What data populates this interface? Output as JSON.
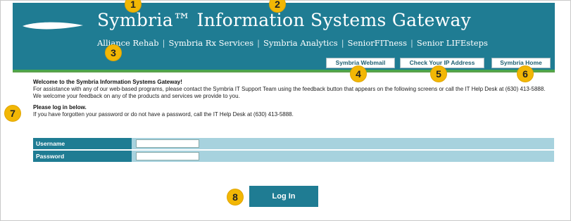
{
  "header": {
    "title": "Symbria™ Information Systems Gateway",
    "nav_links": [
      "Alliance Rehab",
      "Symbria Rx Services",
      "Symbria Analytics",
      "SeniorFITness",
      "Senior LIFEsteps"
    ],
    "separator": "|"
  },
  "toolbar": {
    "buttons": [
      "Symbria Webmail",
      "Check Your IP Address",
      "Symbria Home"
    ]
  },
  "content": {
    "welcome": "Welcome to the Symbria Information Systems Gateway!",
    "assistance": "For assistance with any of our web-based programs, please contact the Symbria IT Support Team using the feedback button that appears on the following screens or call the IT Help Desk at (630) 413-5888. We welcome your feedback on any of the products and services we provide to you.",
    "login_prompt": "Please log in below.",
    "forgot": "If you have forgotten your password or do not have a password, call the IT Help Desk at (630) 413-5888."
  },
  "login": {
    "username_label": "Username",
    "password_label": "Password",
    "username_value": "",
    "password_value": "",
    "button_label": "Log In"
  },
  "markers": [
    "1",
    "2",
    "3",
    "4",
    "5",
    "6",
    "7",
    "8"
  ],
  "colors": {
    "brand_teal": "#1f7c93",
    "accent_green": "#5aa04a",
    "field_bg": "#a7d2de",
    "marker_yellow": "#f2b705"
  }
}
